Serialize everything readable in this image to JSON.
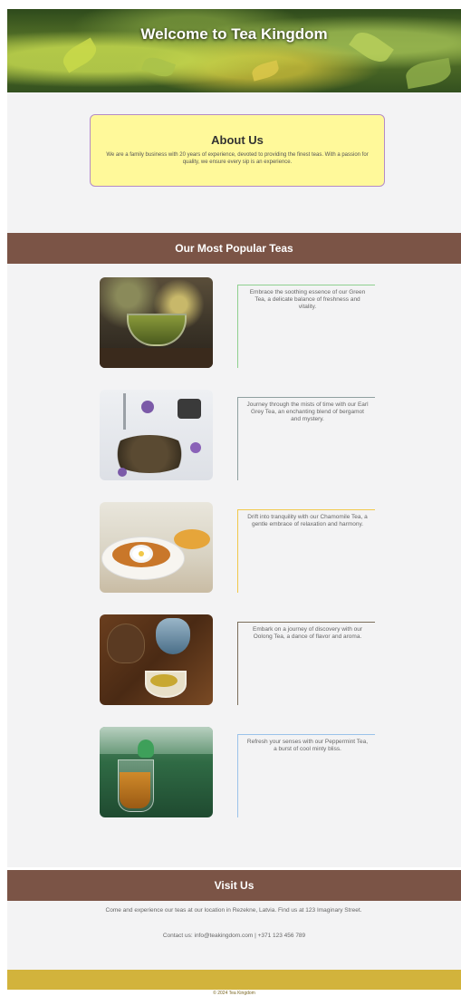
{
  "hero": {
    "title": "Welcome to Tea Kingdom"
  },
  "about": {
    "heading": "About Us",
    "text": "We are a family business with 20 years of experience, devoted to providing the finest teas. With a passion for quality, we ensure every sip is an experience."
  },
  "popular": {
    "heading": "Our Most Popular Teas",
    "teas": [
      {
        "image_icon": "green-tea-cup-image",
        "description": "Embrace the soothing essence of our Green Tea, a delicate balance of freshness and vitality.",
        "accent": "#8fcf8f"
      },
      {
        "image_icon": "earl-grey-leaves-image",
        "description": "Journey through the mists of time with our Earl Grey Tea, an enchanting blend of bergamot and mystery.",
        "accent": "#8fa0a0"
      },
      {
        "image_icon": "chamomile-cup-image",
        "description": "Drift into tranquility with our Chamomile Tea, a gentle embrace of relaxation and harmony.",
        "accent": "#f1c84a"
      },
      {
        "image_icon": "oolong-teapot-image",
        "description": "Embark on a journey of discovery with our Oolong Tea, a dance of flavor and aroma.",
        "accent": "#7a6e5a"
      },
      {
        "image_icon": "peppermint-glass-image",
        "description": "Refresh your senses with our Peppermint Tea, a burst of cool minty bliss.",
        "accent": "#9bc3ea"
      }
    ]
  },
  "visit": {
    "heading": "Visit Us",
    "address": "Come and experience our teas at our location in Rezekne, Latvia. Find us at 123 Imaginary Street.",
    "contact": "Contact us: info@teakingdom.com | +371 123 456 789"
  },
  "footer": {
    "text": "© 2024 Tea Kingdom"
  }
}
